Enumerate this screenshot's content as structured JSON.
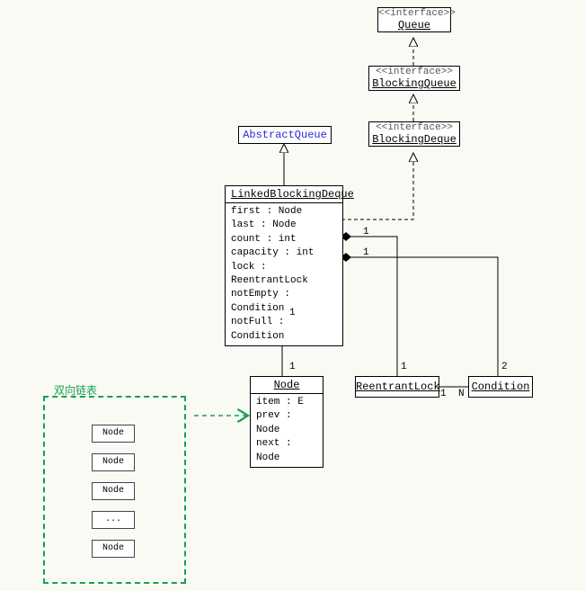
{
  "diagram": {
    "interface_label": "<<interface>>",
    "queue": "Queue",
    "blockingQueue": "BlockingQueue",
    "blockingDeque": "BlockingDeque",
    "abstractQueue": "AbstractQueue",
    "linkedBlockingDeque": {
      "name": "LinkedBlockingDeque",
      "attrs": [
        "first : Node",
        "last : Node",
        "count : int",
        "capacity : int",
        "lock : ReentrantLock",
        "notEmpty : Condition",
        "notFull : Condition"
      ]
    },
    "node": {
      "name": "Node",
      "attrs": [
        "item : E",
        "prev : Node",
        "next : Node"
      ]
    },
    "reentrantLock": "ReentrantLock",
    "condition": "Condition",
    "linkedList": {
      "title": "双向链表",
      "items": [
        "Node",
        "Node",
        "Node",
        "...",
        "Node"
      ]
    },
    "mults": {
      "lbd_node_top": "1",
      "lbd_node_bottom": "1",
      "lbd_lock_left": "1",
      "lbd_cond_left": "1",
      "lock_right": "1",
      "cond_right": "2",
      "lock_cond_left": "1",
      "lock_cond_right": "N"
    }
  }
}
